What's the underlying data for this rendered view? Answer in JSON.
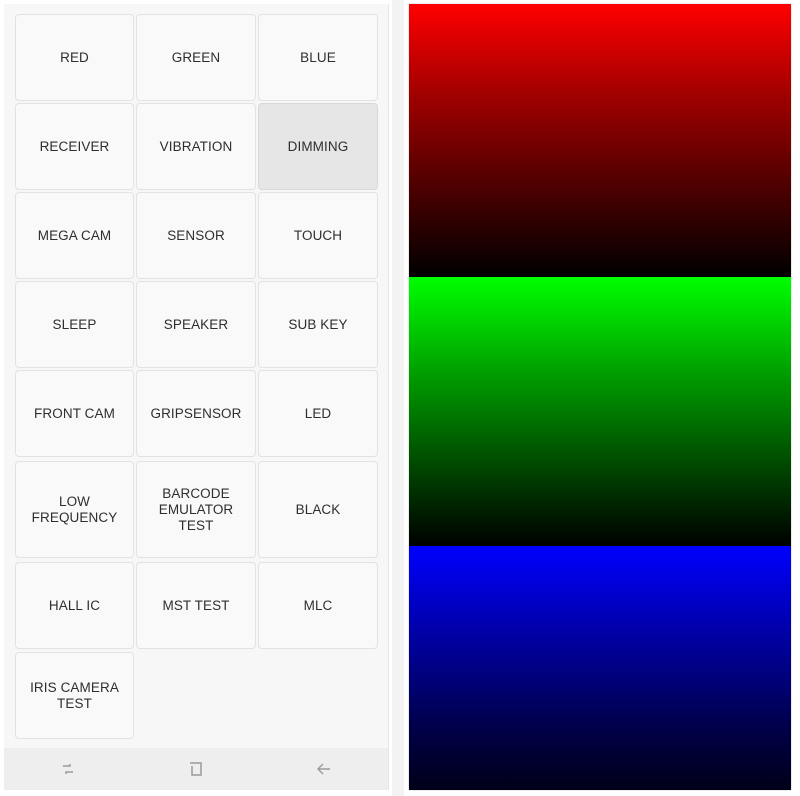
{
  "test_menu": {
    "buttons": [
      {
        "label": "RED"
      },
      {
        "label": "GREEN"
      },
      {
        "label": "BLUE"
      },
      {
        "label": "RECEIVER"
      },
      {
        "label": "VIBRATION"
      },
      {
        "label": "DIMMING",
        "pressed": true
      },
      {
        "label": "MEGA CAM"
      },
      {
        "label": "SENSOR"
      },
      {
        "label": "TOUCH"
      },
      {
        "label": "SLEEP"
      },
      {
        "label": "SPEAKER"
      },
      {
        "label": "SUB KEY"
      },
      {
        "label": "FRONT CAM"
      },
      {
        "label": "GRIPSENSOR"
      },
      {
        "label": "LED"
      },
      {
        "label": "LOW FREQUENCY"
      },
      {
        "label": "BARCODE EMULATOR TEST"
      },
      {
        "label": "BLACK"
      },
      {
        "label": "HALL IC"
      },
      {
        "label": "MST TEST"
      },
      {
        "label": "MLC"
      },
      {
        "label": "IRIS CAMERA TEST"
      }
    ]
  },
  "navbar": {
    "icons": [
      "recent-apps-icon",
      "home-icon",
      "back-icon"
    ]
  },
  "dimming_display": {
    "bands": [
      {
        "name": "red",
        "color": "#ff0000"
      },
      {
        "name": "green",
        "color": "#00ff00"
      },
      {
        "name": "blue",
        "color": "#0000ff"
      }
    ]
  }
}
